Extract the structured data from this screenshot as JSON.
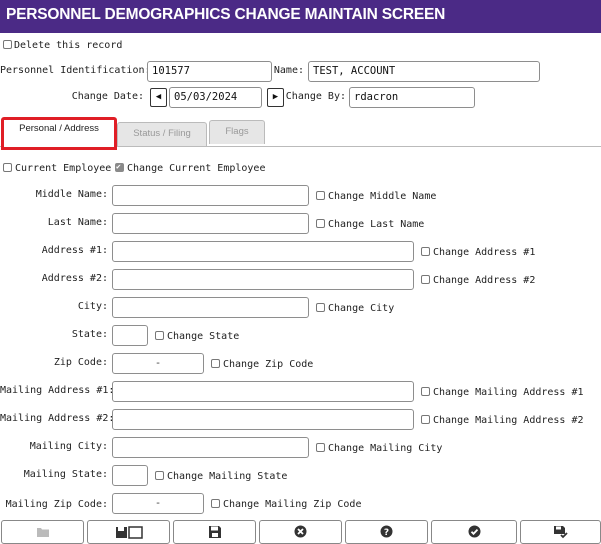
{
  "title": "PERSONNEL DEMOGRAPHICS CHANGE MAINTAIN SCREEN",
  "delete_label": "Delete this record",
  "personnel_id": {
    "label": "Personnel Identification:",
    "value": "101577"
  },
  "name": {
    "label": "Name:",
    "value": "TEST, ACCOUNT"
  },
  "change_date": {
    "label": "Change Date:",
    "value": "05/03/2024"
  },
  "change_by": {
    "label": "Change By:",
    "value": "rdacron"
  },
  "tabs": [
    {
      "label": "Personal / Address",
      "active": true
    },
    {
      "label": "Status / Filing",
      "active": false
    },
    {
      "label": "Flags",
      "active": false
    }
  ],
  "current_employee_label": "Current Employee",
  "change_current_employee_label": "Change Current Employee",
  "change_current_employee_checked": true,
  "fields": {
    "middle_name": {
      "label": "Middle Name:",
      "value": "",
      "change_label": "Change Middle Name"
    },
    "last_name": {
      "label": "Last Name:",
      "value": "",
      "change_label": "Change Last Name"
    },
    "address1": {
      "label": "Address #1:",
      "value": "",
      "change_label": "Change Address #1"
    },
    "address2": {
      "label": "Address #2:",
      "value": "",
      "change_label": "Change Address #2"
    },
    "city": {
      "label": "City:",
      "value": "",
      "change_label": "Change City"
    },
    "state": {
      "label": "State:",
      "value": "",
      "change_label": "Change State"
    },
    "zip": {
      "label": "Zip Code:",
      "value": "-",
      "change_label": "Change Zip Code"
    },
    "mailing_address1": {
      "label": "Mailing Address #1:",
      "value": "",
      "change_label": "Change Mailing Address #1"
    },
    "mailing_address2": {
      "label": "Mailing Address #2:",
      "value": "",
      "change_label": "Change Mailing Address #2"
    },
    "mailing_city": {
      "label": "Mailing City:",
      "value": "",
      "change_label": "Change Mailing City"
    },
    "mailing_state": {
      "label": "Mailing State:",
      "value": "",
      "change_label": "Change Mailing State"
    },
    "mailing_zip": {
      "label": "Mailing Zip Code:",
      "value": "-",
      "change_label": "Change Mailing Zip Code"
    }
  },
  "footer_icons": [
    "folder-icon",
    "save-and-open-icon",
    "save-icon",
    "cancel-icon",
    "help-icon",
    "ok-icon",
    "save-check-icon"
  ],
  "colors": {
    "title_bar": "#4b2a86",
    "active_tab_border": "#e01e26"
  }
}
